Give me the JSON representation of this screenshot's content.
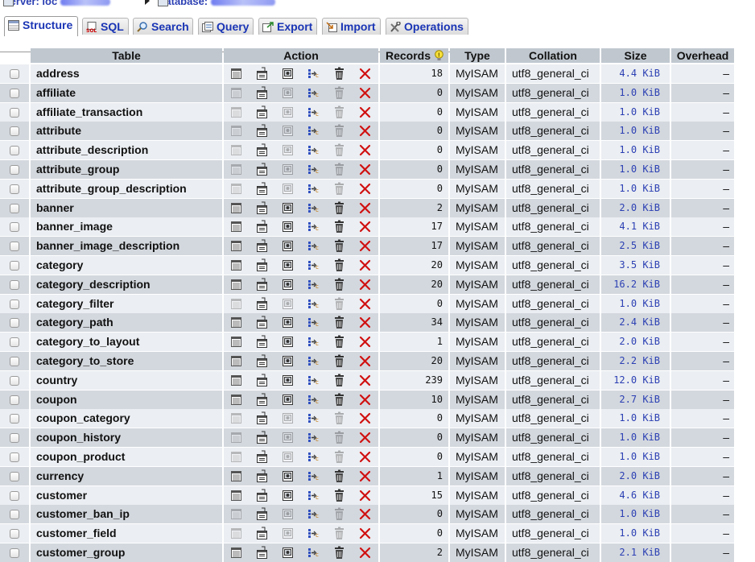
{
  "breadcrumb": {
    "server_label": "Server: loc",
    "database_label": "Database:"
  },
  "tabs": [
    {
      "label": "Structure",
      "icon": "structure-icon",
      "active": true
    },
    {
      "label": "SQL",
      "icon": "sql-icon",
      "active": false
    },
    {
      "label": "Search",
      "icon": "search-icon",
      "active": false
    },
    {
      "label": "Query",
      "icon": "query-icon",
      "active": false
    },
    {
      "label": "Export",
      "icon": "export-icon",
      "active": false
    },
    {
      "label": "Import",
      "icon": "import-icon",
      "active": false
    },
    {
      "label": "Operations",
      "icon": "operations-icon",
      "active": false
    }
  ],
  "columns": {
    "table": "Table",
    "action": "Action",
    "records": "Records",
    "type": "Type",
    "collation": "Collation",
    "size": "Size",
    "overhead": "Overhead"
  },
  "rows": [
    {
      "name": "address",
      "records": "18",
      "type": "MyISAM",
      "collation": "utf8_general_ci",
      "size": "4.4 KiB",
      "overhead": "–"
    },
    {
      "name": "affiliate",
      "records": "0",
      "type": "MyISAM",
      "collation": "utf8_general_ci",
      "size": "1.0 KiB",
      "overhead": "–"
    },
    {
      "name": "affiliate_transaction",
      "records": "0",
      "type": "MyISAM",
      "collation": "utf8_general_ci",
      "size": "1.0 KiB",
      "overhead": "–"
    },
    {
      "name": "attribute",
      "records": "0",
      "type": "MyISAM",
      "collation": "utf8_general_ci",
      "size": "1.0 KiB",
      "overhead": "–"
    },
    {
      "name": "attribute_description",
      "records": "0",
      "type": "MyISAM",
      "collation": "utf8_general_ci",
      "size": "1.0 KiB",
      "overhead": "–"
    },
    {
      "name": "attribute_group",
      "records": "0",
      "type": "MyISAM",
      "collation": "utf8_general_ci",
      "size": "1.0 KiB",
      "overhead": "–"
    },
    {
      "name": "attribute_group_description",
      "records": "0",
      "type": "MyISAM",
      "collation": "utf8_general_ci",
      "size": "1.0 KiB",
      "overhead": "–"
    },
    {
      "name": "banner",
      "records": "2",
      "type": "MyISAM",
      "collation": "utf8_general_ci",
      "size": "2.0 KiB",
      "overhead": "–"
    },
    {
      "name": "banner_image",
      "records": "17",
      "type": "MyISAM",
      "collation": "utf8_general_ci",
      "size": "4.1 KiB",
      "overhead": "–"
    },
    {
      "name": "banner_image_description",
      "records": "17",
      "type": "MyISAM",
      "collation": "utf8_general_ci",
      "size": "2.5 KiB",
      "overhead": "–"
    },
    {
      "name": "category",
      "records": "20",
      "type": "MyISAM",
      "collation": "utf8_general_ci",
      "size": "3.5 KiB",
      "overhead": "–"
    },
    {
      "name": "category_description",
      "records": "20",
      "type": "MyISAM",
      "collation": "utf8_general_ci",
      "size": "16.2 KiB",
      "overhead": "–"
    },
    {
      "name": "category_filter",
      "records": "0",
      "type": "MyISAM",
      "collation": "utf8_general_ci",
      "size": "1.0 KiB",
      "overhead": "–"
    },
    {
      "name": "category_path",
      "records": "34",
      "type": "MyISAM",
      "collation": "utf8_general_ci",
      "size": "2.4 KiB",
      "overhead": "–"
    },
    {
      "name": "category_to_layout",
      "records": "1",
      "type": "MyISAM",
      "collation": "utf8_general_ci",
      "size": "2.0 KiB",
      "overhead": "–"
    },
    {
      "name": "category_to_store",
      "records": "20",
      "type": "MyISAM",
      "collation": "utf8_general_ci",
      "size": "2.2 KiB",
      "overhead": "–"
    },
    {
      "name": "country",
      "records": "239",
      "type": "MyISAM",
      "collation": "utf8_general_ci",
      "size": "12.0 KiB",
      "overhead": "–"
    },
    {
      "name": "coupon",
      "records": "10",
      "type": "MyISAM",
      "collation": "utf8_general_ci",
      "size": "2.7 KiB",
      "overhead": "–"
    },
    {
      "name": "coupon_category",
      "records": "0",
      "type": "MyISAM",
      "collation": "utf8_general_ci",
      "size": "1.0 KiB",
      "overhead": "–"
    },
    {
      "name": "coupon_history",
      "records": "0",
      "type": "MyISAM",
      "collation": "utf8_general_ci",
      "size": "1.0 KiB",
      "overhead": "–"
    },
    {
      "name": "coupon_product",
      "records": "0",
      "type": "MyISAM",
      "collation": "utf8_general_ci",
      "size": "1.0 KiB",
      "overhead": "–"
    },
    {
      "name": "currency",
      "records": "1",
      "type": "MyISAM",
      "collation": "utf8_general_ci",
      "size": "2.0 KiB",
      "overhead": "–"
    },
    {
      "name": "customer",
      "records": "15",
      "type": "MyISAM",
      "collation": "utf8_general_ci",
      "size": "4.6 KiB",
      "overhead": "–"
    },
    {
      "name": "customer_ban_ip",
      "records": "0",
      "type": "MyISAM",
      "collation": "utf8_general_ci",
      "size": "1.0 KiB",
      "overhead": "–"
    },
    {
      "name": "customer_field",
      "records": "0",
      "type": "MyISAM",
      "collation": "utf8_general_ci",
      "size": "1.0 KiB",
      "overhead": "–"
    },
    {
      "name": "customer_group",
      "records": "2",
      "type": "MyISAM",
      "collation": "utf8_general_ci",
      "size": "2.1 KiB",
      "overhead": "–"
    }
  ],
  "colors": {
    "header_bg": "#c0c7cf",
    "row_odd": "#ebeef2",
    "row_even": "#d3d8de",
    "link_blue": "#2b3fb3",
    "drop_red": "#d01010"
  }
}
